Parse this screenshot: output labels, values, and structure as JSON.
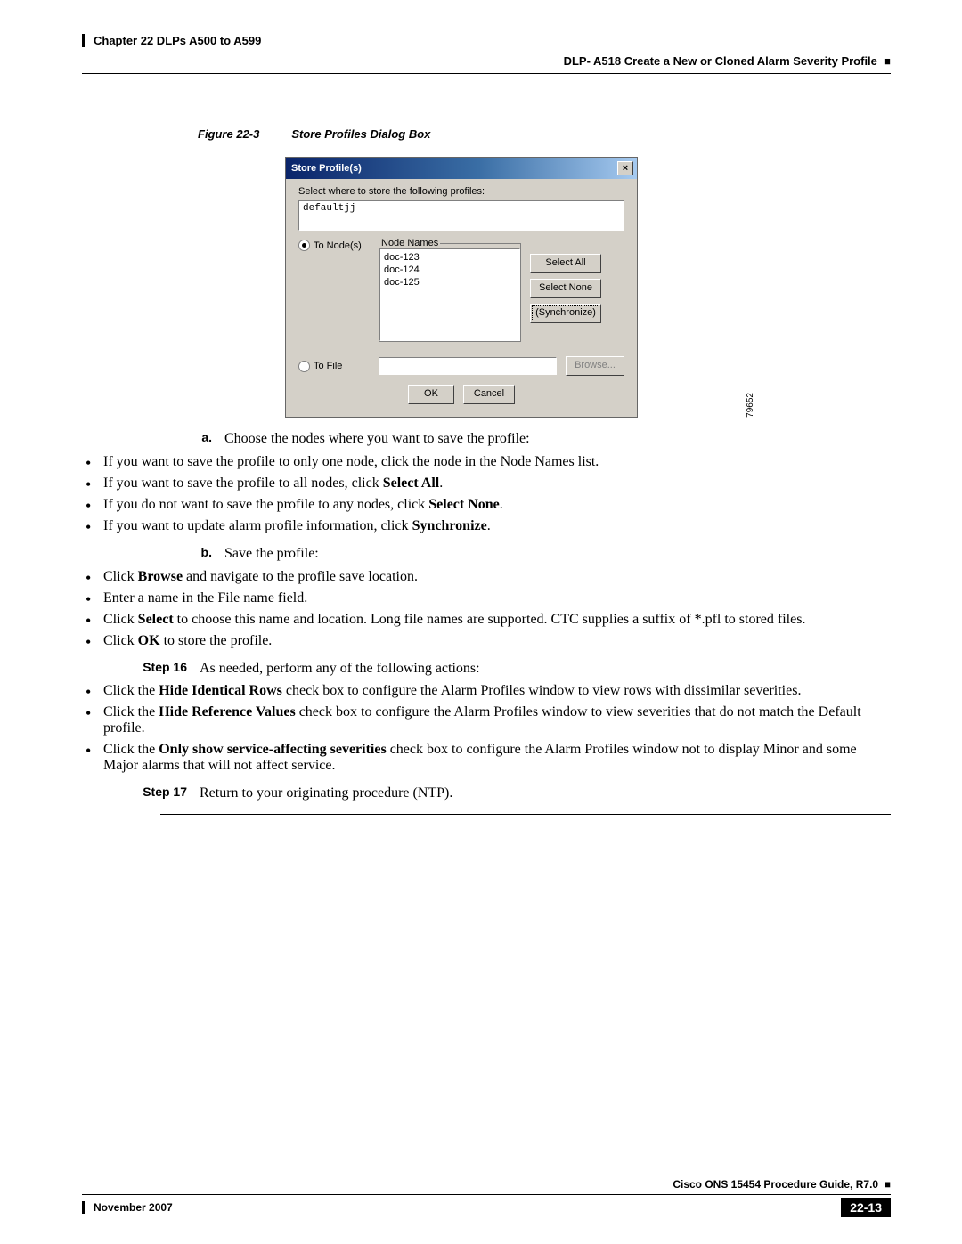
{
  "header": {
    "chapter": "Chapter 22    DLPs A500 to A599",
    "section": "DLP- A518 Create a New or Cloned Alarm Severity Profile"
  },
  "figure": {
    "label": "Figure 22-3",
    "title": "Store Profiles Dialog Box",
    "image_id": "79652"
  },
  "dialog": {
    "title": "Store Profile(s)",
    "instruction": "Select where to store the following profiles:",
    "profile": "defaultjj",
    "radio_nodes": "To Node(s)",
    "radio_file": "To File",
    "legend": "Node Names",
    "nodes": [
      "doc-123",
      "doc-124",
      "doc-125"
    ],
    "btn_select_all": "Select All",
    "btn_select_none": "Select None",
    "btn_synchronize": "(Synchronize)",
    "btn_browse": "Browse...",
    "btn_ok": "OK",
    "btn_cancel": "Cancel"
  },
  "steps": {
    "a_label": "a.",
    "a_text": "Choose the nodes where you want to save the profile:",
    "a_bullets": [
      "If you want to save the profile to only one node, click the node in the Node Names list.",
      "If you want to save the profile to all nodes, click <b>Select All</b>.",
      "If you do not want to save the profile to any nodes, click <b>Select None</b>.",
      "If you want to update alarm profile information, click <b>Synchronize</b>."
    ],
    "b_label": "b.",
    "b_text": "Save the profile:",
    "b_bullets": [
      "Click <b>Browse</b> and navigate to the profile save location.",
      "Enter a name in the File name field.",
      "Click <b>Select</b> to choose this name and location. Long file names are supported. CTC supplies a suffix of *.pfl to stored files.",
      "Click <b>OK</b> to store the profile."
    ],
    "s16_label": "Step 16",
    "s16_text": "As needed, perform any of the following actions:",
    "s16_bullets": [
      "Click the <b>Hide Identical Rows</b> check box to configure the Alarm Profiles window to view rows with dissimilar severities.",
      "Click the <b>Hide Reference Values</b> check box to configure the Alarm Profiles window to view severities that do not match the Default profile.",
      "Click the <b>Only show service-affecting severities</b> check box to configure the Alarm Profiles window not to display Minor and some Major alarms that will not affect service."
    ],
    "s17_label": "Step 17",
    "s17_text": "Return to your originating procedure (NTP)."
  },
  "footer": {
    "guide": "Cisco ONS 15454 Procedure Guide, R7.0",
    "date": "November 2007",
    "page": "22-13"
  }
}
